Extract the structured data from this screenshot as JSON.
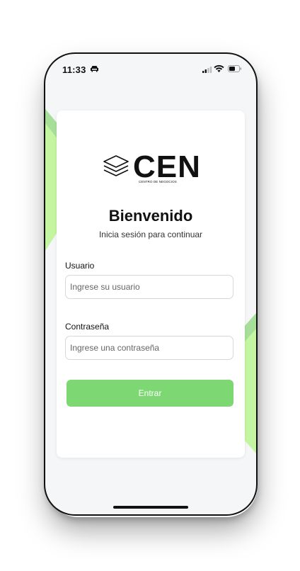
{
  "status_bar": {
    "time": "11:33"
  },
  "logo": {
    "text": "CEN",
    "subtext": "CENTRO DE NEGOCIOS"
  },
  "login": {
    "title": "Bienvenido",
    "subtitle": "Inicia sesión para continuar",
    "username_label": "Usuario",
    "username_placeholder": "Ingrese su usuario",
    "password_label": "Contraseña",
    "password_placeholder": "Ingrese una contraseña",
    "submit_label": "Entrar"
  },
  "colors": {
    "accent": "#7dd874",
    "deco_light": "#c4f5a0",
    "deco_dark": "#a7df9a"
  }
}
